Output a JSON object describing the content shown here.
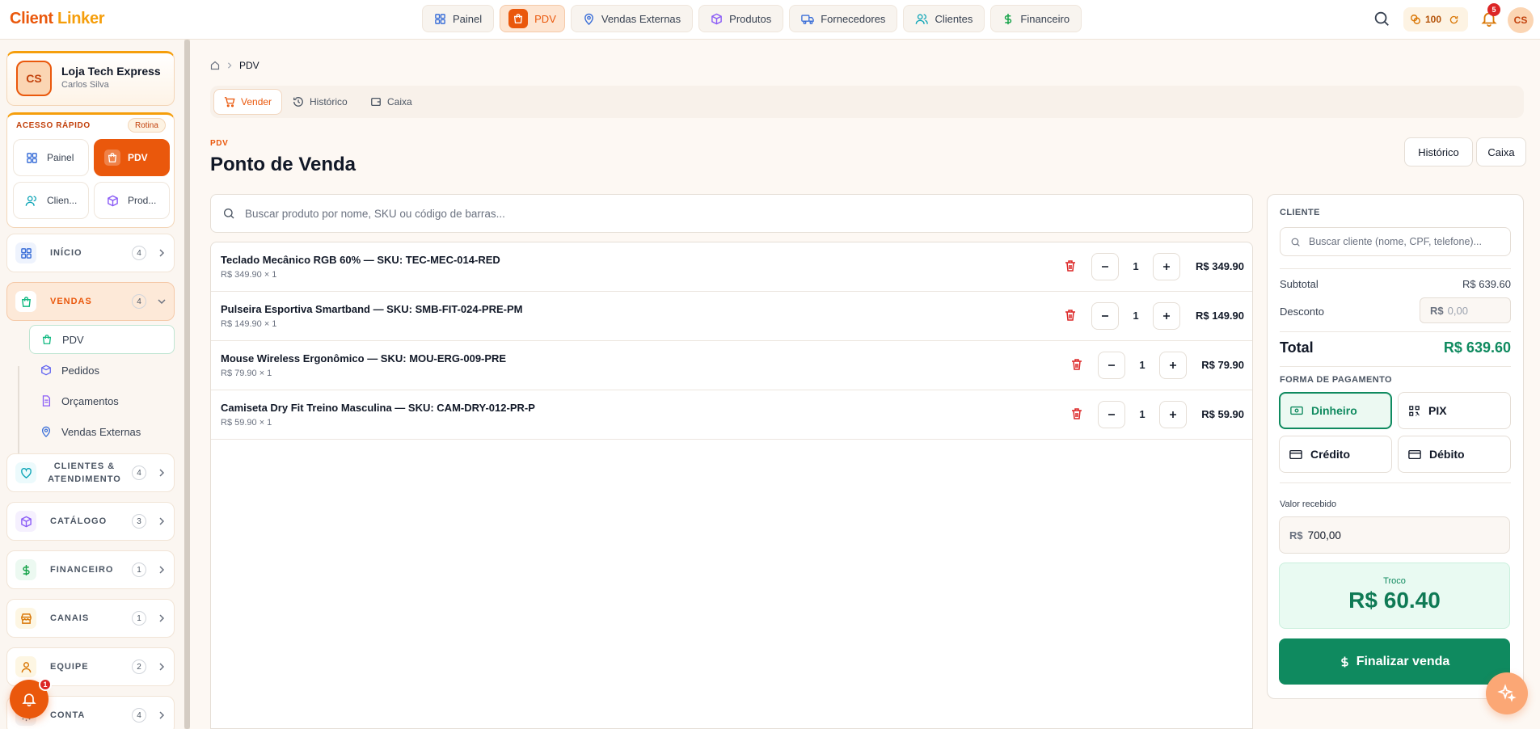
{
  "app": {
    "brand_a": "Client",
    "brand_b": "Linker"
  },
  "topnav": {
    "items": [
      {
        "label": "Painel",
        "icon": "grid-icon"
      },
      {
        "label": "PDV",
        "icon": "shopping-bag-icon"
      },
      {
        "label": "Vendas Externas",
        "icon": "map-pin-icon"
      },
      {
        "label": "Produtos",
        "icon": "box-icon"
      },
      {
        "label": "Fornecedores",
        "icon": "truck-icon"
      },
      {
        "label": "Clientes",
        "icon": "users-icon"
      },
      {
        "label": "Financeiro",
        "icon": "dollar-icon"
      }
    ],
    "coins": "100",
    "notifications": "5",
    "user_initials": "CS"
  },
  "store": {
    "initials": "CS",
    "name": "Loja Tech Express",
    "user": "Carlos Silva"
  },
  "quick": {
    "title": "ACESSO RÁPIDO",
    "badge": "Rotina",
    "items": [
      {
        "label": "Painel"
      },
      {
        "label": "PDV"
      },
      {
        "label": "Clien..."
      },
      {
        "label": "Prod..."
      }
    ]
  },
  "sidebar": {
    "sections": [
      {
        "label": "INÍCIO",
        "count": "4"
      },
      {
        "label": "VENDAS",
        "count": "4"
      },
      {
        "label": "CLIENTES & ATENDIMENTO",
        "count": "4"
      },
      {
        "label": "CATÁLOGO",
        "count": "3"
      },
      {
        "label": "FINANCEIRO",
        "count": "1"
      },
      {
        "label": "CANAIS",
        "count": "1"
      },
      {
        "label": "EQUIPE",
        "count": "2"
      },
      {
        "label": "CONTA",
        "count": "4"
      }
    ],
    "vendas_items": [
      {
        "label": "PDV"
      },
      {
        "label": "Pedidos"
      },
      {
        "label": "Orçamentos"
      },
      {
        "label": "Vendas Externas"
      }
    ],
    "float_badge": "1"
  },
  "breadcrumb": {
    "current": "PDV"
  },
  "tabs": [
    {
      "label": "Vender"
    },
    {
      "label": "Histórico"
    },
    {
      "label": "Caixa"
    }
  ],
  "page": {
    "kicker": "PDV",
    "title": "Ponto de Venda",
    "btn_historico": "Histórico",
    "btn_caixa": "Caixa",
    "search_placeholder": "Buscar produto por nome, SKU ou código de barras..."
  },
  "cart": [
    {
      "name": "Teclado Mecânico RGB 60% — SKU: TEC-MEC-014-RED",
      "price": "R$ 349.90 × 1",
      "qty": "1",
      "total": "R$ 349.90"
    },
    {
      "name": "Pulseira Esportiva Smartband — SKU: SMB-FIT-024-PRE-PM",
      "price": "R$ 149.90 × 1",
      "qty": "1",
      "total": "R$ 149.90"
    },
    {
      "name": "Mouse Wireless Ergonômico — SKU: MOU-ERG-009-PRE",
      "price": "R$ 79.90 × 1",
      "qty": "1",
      "total": "R$ 79.90"
    },
    {
      "name": "Camiseta Dry Fit Treino Masculina — SKU: CAM-DRY-012-PR-P",
      "price": "R$ 59.90 × 1",
      "qty": "1",
      "total": "R$ 59.90"
    }
  ],
  "checkout": {
    "cliente_label": "CLIENTE",
    "cliente_placeholder": "Buscar cliente (nome, CPF, telefone)...",
    "subtotal_label": "Subtotal",
    "subtotal": "R$ 639.60",
    "desconto_label": "Desconto",
    "desconto_prefix": "R$",
    "desconto_placeholder": "0,00",
    "total_label": "Total",
    "total": "R$ 639.60",
    "pagamento_label": "FORMA DE PAGAMENTO",
    "methods": [
      {
        "label": "Dinheiro"
      },
      {
        "label": "PIX"
      },
      {
        "label": "Crédito"
      },
      {
        "label": "Débito"
      }
    ],
    "recebido_label": "Valor recebido",
    "recebido_prefix": "R$",
    "recebido_value": "700,00",
    "troco_label": "Troco",
    "troco_value": "R$ 60.40",
    "finalizar": "Finalizar venda"
  },
  "colors": {
    "accent": "#ea580c",
    "success": "#0f8a5f",
    "danger": "#dc2626"
  }
}
